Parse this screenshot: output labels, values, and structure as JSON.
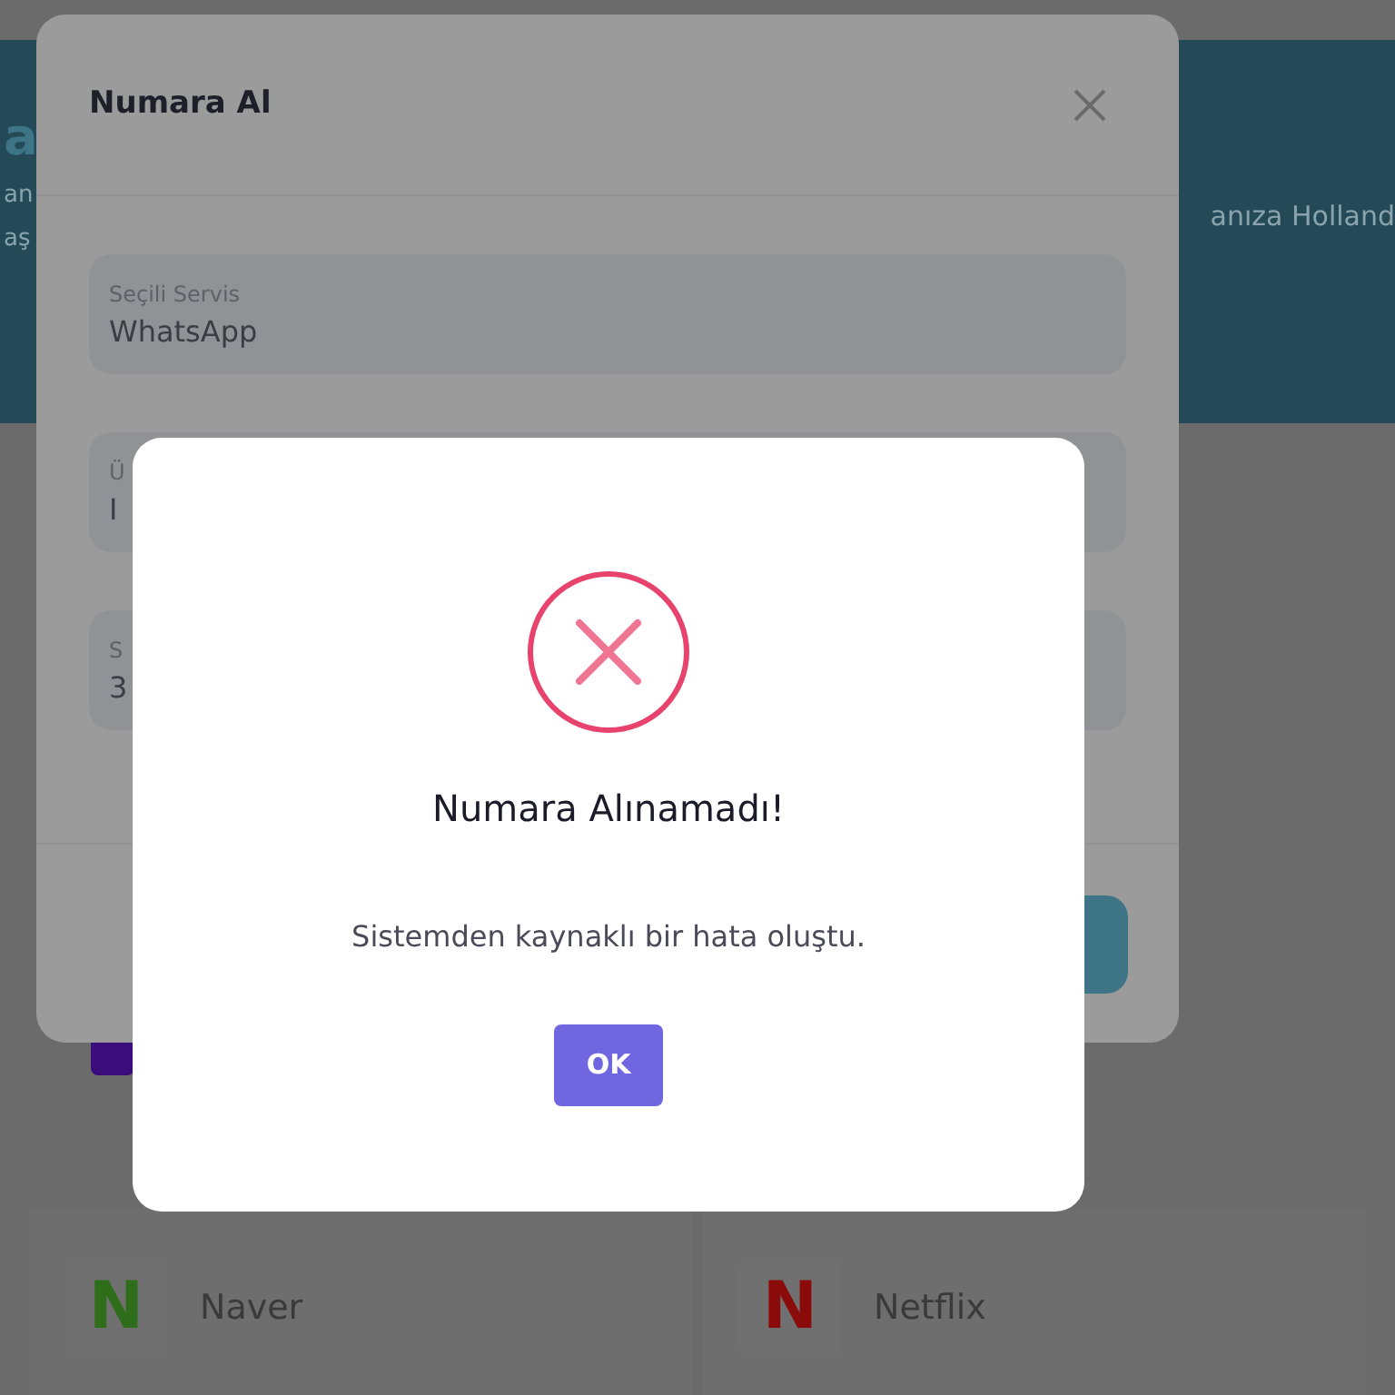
{
  "page": {
    "banner_title": "a",
    "banner_line_left": "an",
    "banner_line_left_2": "aş",
    "banner_line_right": "anıza Holland",
    "services": [
      {
        "name": "Naver",
        "letter": "N",
        "color": "#2e6e1a"
      },
      {
        "name": "Netflix",
        "letter": "N",
        "color": "#8b0a0a"
      }
    ]
  },
  "modal": {
    "title": "Numara Al",
    "fields": [
      {
        "label": "Seçili Servis",
        "value": "WhatsApp"
      },
      {
        "label": "Ü",
        "value": "I"
      },
      {
        "label": "S",
        "value": "3"
      }
    ]
  },
  "alert": {
    "title": "Numara Alınamadı!",
    "message": "Sistemden kaynaklı bir hata oluştu.",
    "button": "OK"
  }
}
